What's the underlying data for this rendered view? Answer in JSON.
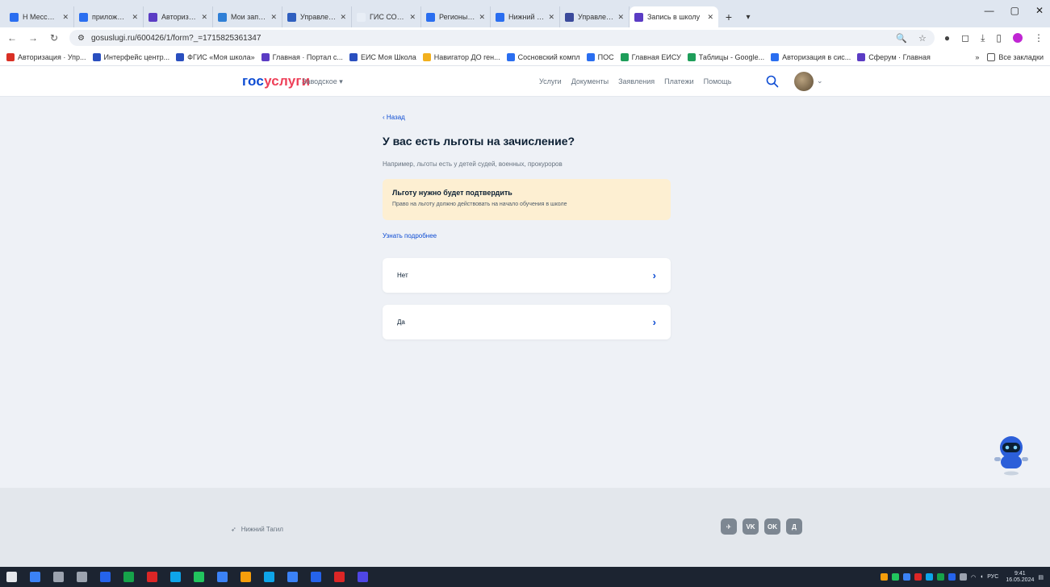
{
  "browser": {
    "tabs": [
      {
        "title": "Н Мессенджер",
        "color": "#2a6ef0"
      },
      {
        "title": "приложение И",
        "color": "#2a6ef0"
      },
      {
        "title": "Авторизация",
        "color": "#5b3cc4"
      },
      {
        "title": "Мои запросы",
        "color": "#2f7fd6"
      },
      {
        "title": "Управление ОО",
        "color": "#2f5fbf"
      },
      {
        "title": "ГИС СО \"ЦР\"",
        "color": "#e8eef6"
      },
      {
        "title": "Регионы - Пол",
        "color": "#2a6ef0"
      },
      {
        "title": "Нижний Тагил",
        "color": "#2a6ef0"
      },
      {
        "title": "Управление Д",
        "color": "#3b4a9b"
      },
      {
        "title": "Запись в школу",
        "color": "#5b3cc4",
        "active": true
      }
    ],
    "new_tab": "+",
    "window_controls": {
      "minimize": "—",
      "maximize": "▢",
      "close": "✕"
    },
    "url": "gosuslugi.ru/600426/1/form?_=1715825361347",
    "bookmarks": [
      {
        "label": "Авторизация · Упр...",
        "color": "#d93025"
      },
      {
        "label": "Интерфейс центр...",
        "color": "#2a4fbf"
      },
      {
        "label": "ФГИС «Моя школа»",
        "color": "#2a4fbf"
      },
      {
        "label": "Главная · Портал с...",
        "color": "#5b3cc4"
      },
      {
        "label": "ЕИС Моя Школа",
        "color": "#2a4fbf"
      },
      {
        "label": "Навигатор ДО ген...",
        "color": "#f2b01e"
      },
      {
        "label": "Cосновский компл",
        "color": "#2a6ef0"
      },
      {
        "label": "ПОС",
        "color": "#2a6ef0"
      },
      {
        "label": "Главная ЕИСУ",
        "color": "#1e9e5a"
      },
      {
        "label": "Таблицы - Google...",
        "color": "#1e9e5a"
      },
      {
        "label": "Авторизация в сис...",
        "color": "#2a6ef0"
      },
      {
        "label": "Сферум · Главная",
        "color": "#5b3cc4"
      }
    ],
    "bookmarks_more": "»",
    "all_bookmarks": "Все закладки"
  },
  "site": {
    "logo_part1": "гос",
    "logo_part2": "услуги",
    "region": "Заводское ▾",
    "nav": [
      "Услуги",
      "Документы",
      "Заявления",
      "Платежи",
      "Помощь"
    ]
  },
  "form": {
    "back": "‹ Назад",
    "title": "У вас есть льготы на зачисление?",
    "subtitle": "Например, льготы есть у детей судей, военных, прокуроров",
    "warning_title": "Льготу нужно будет подтвердить",
    "warning_text": "Право на льготу должно действовать на начало обучения в школе",
    "more": "Узнать подробнее",
    "options": [
      {
        "label": "Нет"
      },
      {
        "label": "Да"
      }
    ]
  },
  "footer": {
    "location": "Нижний Тагил",
    "socials": [
      "✈",
      "VK",
      "OK",
      "Д"
    ]
  },
  "taskbar": {
    "apps": [
      "#3b82f6",
      "#9ca3af",
      "#9ca3af",
      "#2563eb",
      "#16a34a",
      "#dc2626",
      "#0ea5e9",
      "#22c55e",
      "#3b82f6",
      "#f59e0b",
      "#0ea5e9",
      "#3b82f6",
      "#2563eb",
      "#dc2626",
      "#4f46e5"
    ],
    "lang": "РУС",
    "time": "9:41",
    "date": "16.05.2024"
  }
}
